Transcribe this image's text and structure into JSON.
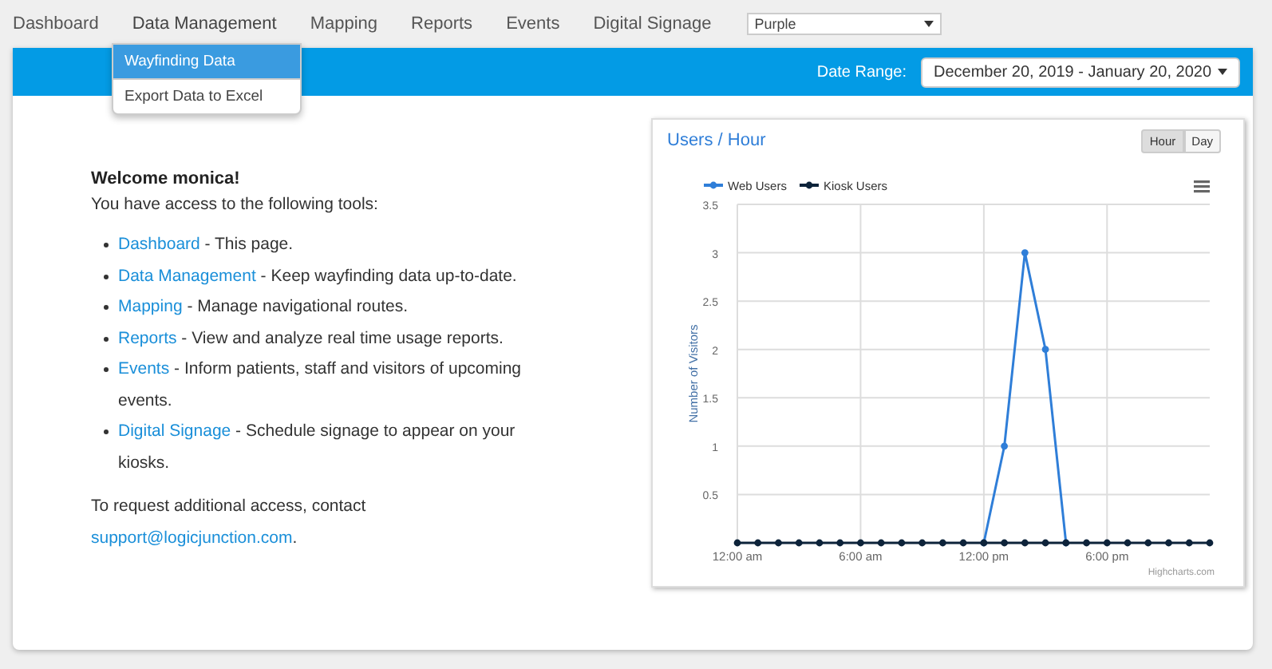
{
  "nav": {
    "items": [
      {
        "label": "Dashboard",
        "expanded": false
      },
      {
        "label": "Data Management",
        "expanded": true
      },
      {
        "label": "Mapping",
        "expanded": false
      },
      {
        "label": "Reports",
        "expanded": false
      },
      {
        "label": "Events",
        "expanded": false
      },
      {
        "label": "Digital Signage",
        "expanded": false
      }
    ],
    "theme_select": {
      "value": "Purple"
    }
  },
  "dropdown": {
    "items": [
      {
        "label": "Wayfinding Data",
        "selected": true
      },
      {
        "label": "Export Data to Excel",
        "selected": false
      }
    ]
  },
  "header": {
    "date_label": "Date Range:",
    "date_value": "December 20, 2019 - January 20, 2020"
  },
  "welcome": {
    "title": "Welcome monica!",
    "intro": "You have access to the following tools:",
    "tools": [
      {
        "link": "Dashboard",
        "text": " - This page."
      },
      {
        "link": "Data Management",
        "text": " - Keep wayfinding data up-to-date."
      },
      {
        "link": "Mapping",
        "text": " - Manage navigational routes."
      },
      {
        "link": "Reports",
        "text": " - View and analyze real time usage reports."
      },
      {
        "link": "Events",
        "text": " - Inform patients, staff and visitors of upcoming events."
      },
      {
        "link": "Digital Signage",
        "text": " - Schedule signage to appear on your kiosks."
      }
    ],
    "contact": {
      "text": "To request additional access, contact ",
      "link": "support@logicjunction.com",
      "suffix": "."
    }
  },
  "chart_card": {
    "title": "Users / Hour",
    "toggles": [
      {
        "label": "Hour",
        "selected": true
      },
      {
        "label": "Day",
        "selected": false
      }
    ],
    "credits": "Highcharts.com",
    "chart_data": {
      "type": "line",
      "ylabel": "Number of Visitors",
      "x": [
        0,
        1,
        2,
        3,
        4,
        5,
        6,
        7,
        8,
        9,
        10,
        11,
        12,
        13,
        14,
        15,
        16,
        17,
        18,
        19,
        20,
        21,
        22,
        23
      ],
      "xlim": [
        0,
        23
      ],
      "ylim": [
        0,
        3.5
      ],
      "xticks": [
        {
          "value": 0,
          "label": "12:00 am"
        },
        {
          "value": 6,
          "label": "6:00 am"
        },
        {
          "value": 12,
          "label": "12:00 pm"
        },
        {
          "value": 18,
          "label": "6:00 pm"
        }
      ],
      "yticks": [
        0.5,
        1,
        1.5,
        2,
        2.5,
        3,
        3.5
      ],
      "grid": true,
      "legend": true,
      "series": [
        {
          "name": "Web Users",
          "color": "#2f7ed8",
          "marker": true,
          "values": [
            null,
            null,
            null,
            null,
            null,
            null,
            null,
            null,
            null,
            null,
            null,
            null,
            0,
            1,
            3,
            2,
            0,
            null,
            null,
            null,
            null,
            null,
            null,
            null
          ]
        },
        {
          "name": "Kiosk Users",
          "color": "#0d233a",
          "marker": true,
          "values": [
            0,
            0,
            0,
            0,
            0,
            0,
            0,
            0,
            0,
            0,
            0,
            0,
            0,
            0,
            0,
            0,
            0,
            0,
            0,
            0,
            0,
            0,
            0,
            0
          ]
        }
      ]
    }
  }
}
